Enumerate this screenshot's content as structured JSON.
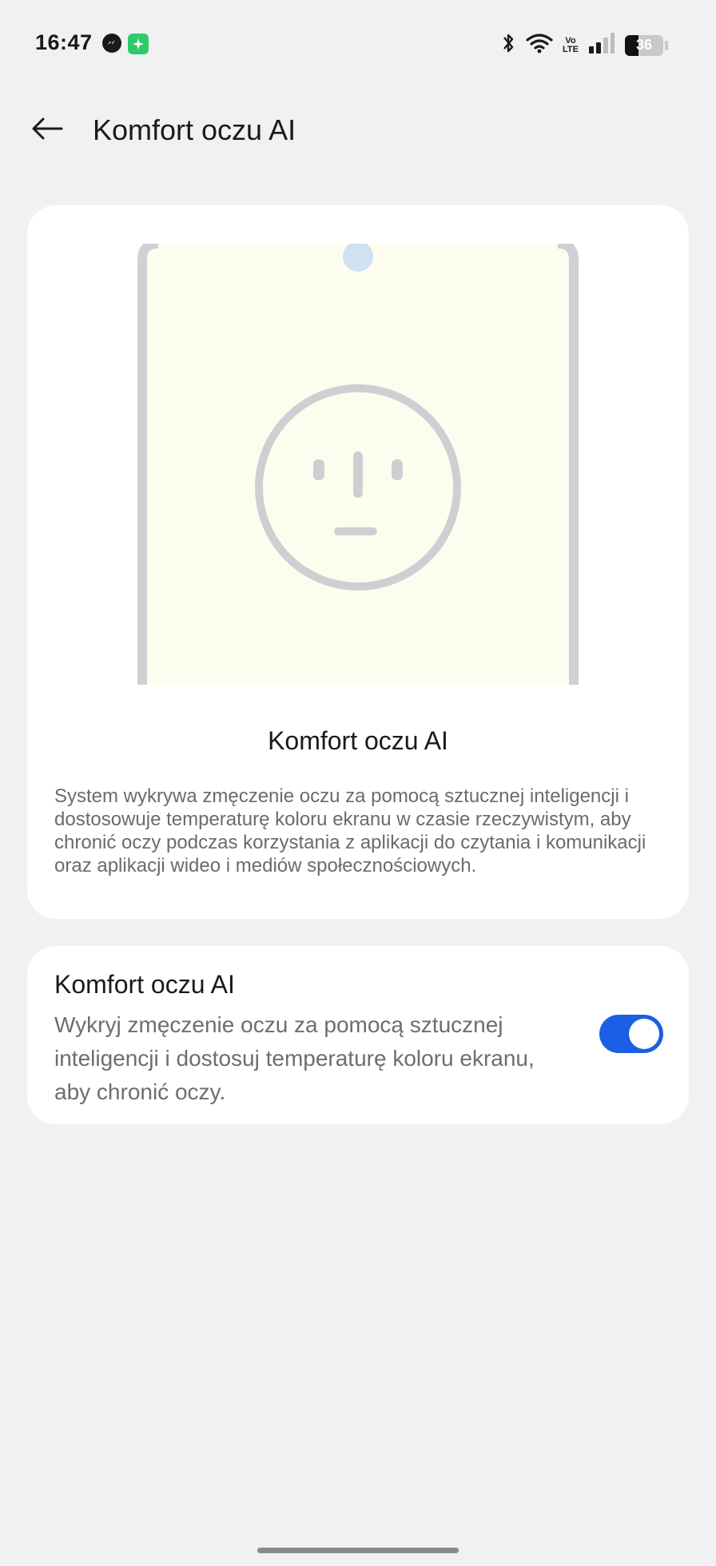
{
  "status_bar": {
    "time": "16:47",
    "notification_icons": [
      "messenger-icon",
      "spark-app-icon"
    ],
    "system_icons": [
      "bluetooth-icon",
      "wifi-icon",
      "volte-icon",
      "signal-icon",
      "battery-icon"
    ],
    "volte_label_top": "Vo",
    "volte_label_bottom": "LTE",
    "battery_level": "36",
    "battery_fraction": 0.36
  },
  "header": {
    "back_icon": "arrow-left-icon",
    "title": "Komfort oczu AI"
  },
  "illustration_card": {
    "illustration": "phone-with-neutral-face",
    "screen_color": "#fdfdef",
    "frame_color": "#d0d0d5",
    "camera_color": "#cfe1f2",
    "title": "Komfort oczu AI",
    "description": "System wykrywa zmęczenie oczu za pomocą sztucznej inteligencji i dostosowuje temperaturę koloru ekranu w czasie rzeczywistym, aby chronić oczy podczas korzystania z aplikacji do czytania i komunikacji oraz aplikacji wideo i mediów społecznościowych."
  },
  "toggle_card": {
    "title": "Komfort oczu AI",
    "description": "Wykryj zmęczenie oczu za pomocą sztucznej inteligencji i dostosuj temperaturę koloru ekranu, aby chronić oczy.",
    "enabled": true,
    "switch_color": "#1a5fe6"
  },
  "colors": {
    "background": "#f0f1f3",
    "card": "#ffffff",
    "accent": "#1a5fe6"
  }
}
